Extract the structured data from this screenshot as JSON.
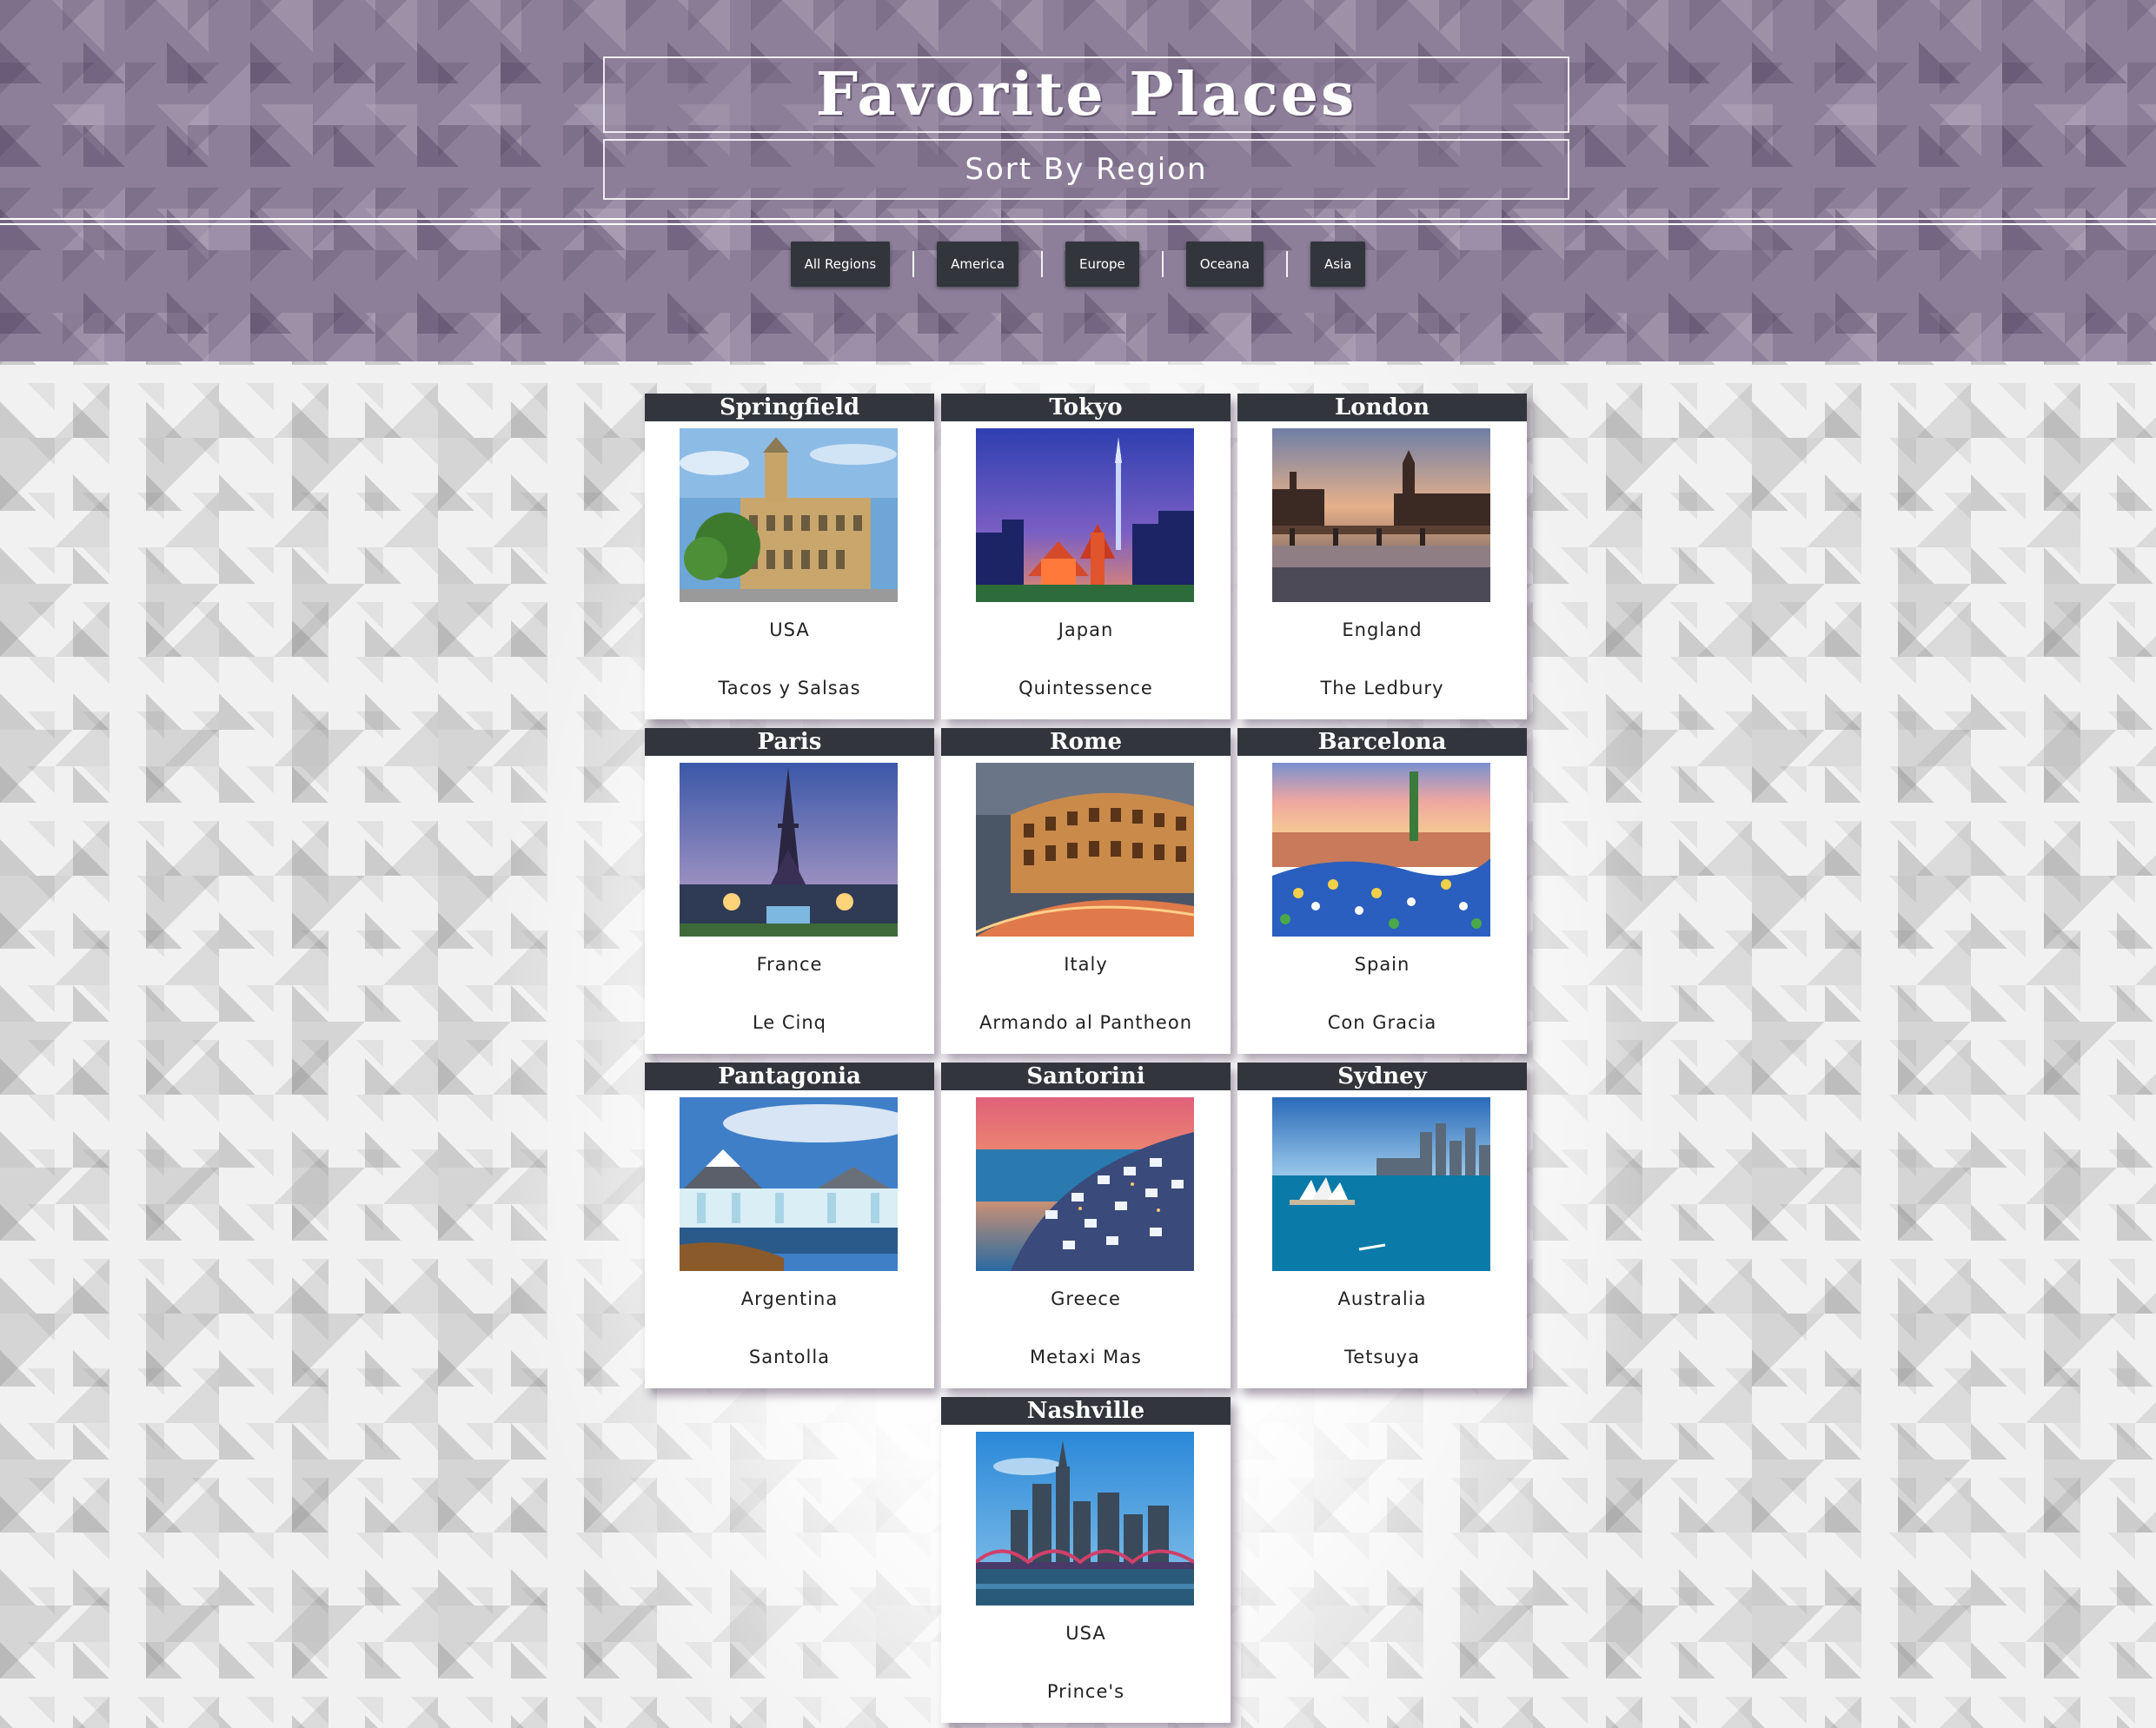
{
  "page": {
    "title": "Favorite Places",
    "subtitle": "Sort By Region"
  },
  "nav": {
    "items": [
      {
        "label": "All Regions"
      },
      {
        "label": "America"
      },
      {
        "label": "Europe"
      },
      {
        "label": "Oceana"
      },
      {
        "label": "Asia"
      }
    ]
  },
  "cards": [
    {
      "city": "Springfield",
      "country": "USA",
      "restaurant": "Tacos y Salsas",
      "image": "building-photo"
    },
    {
      "city": "Tokyo",
      "country": "Japan",
      "restaurant": "Quintessence",
      "image": "city-skyline-photo"
    },
    {
      "city": "London",
      "country": "England",
      "restaurant": "The Ledbury",
      "image": "river-city-photo"
    },
    {
      "city": "Paris",
      "country": "France",
      "restaurant": "Le Cinq",
      "image": "eiffel-tower-photo"
    },
    {
      "city": "Rome",
      "country": "Italy",
      "restaurant": "Armando al Pantheon",
      "image": "colosseum-photo"
    },
    {
      "city": "Barcelona",
      "country": "Spain",
      "restaurant": "Con Gracia",
      "image": "mosaic-park-photo"
    },
    {
      "city": "Pantagonia",
      "country": "Argentina",
      "restaurant": "Santolla",
      "image": "glacier-photo"
    },
    {
      "city": "Santorini",
      "country": "Greece",
      "restaurant": "Metaxi Mas",
      "image": "cliff-village-photo"
    },
    {
      "city": "Sydney",
      "country": "Australia",
      "restaurant": "Tetsuya",
      "image": "harbour-photo"
    },
    {
      "city": "Nashville",
      "country": "USA",
      "restaurant": "Prince's",
      "image": "bridge-skyline-photo"
    }
  ],
  "colors": {
    "header": "#8d7f99",
    "card_title_bar": "#32363c",
    "nav_button": "#32363c"
  }
}
